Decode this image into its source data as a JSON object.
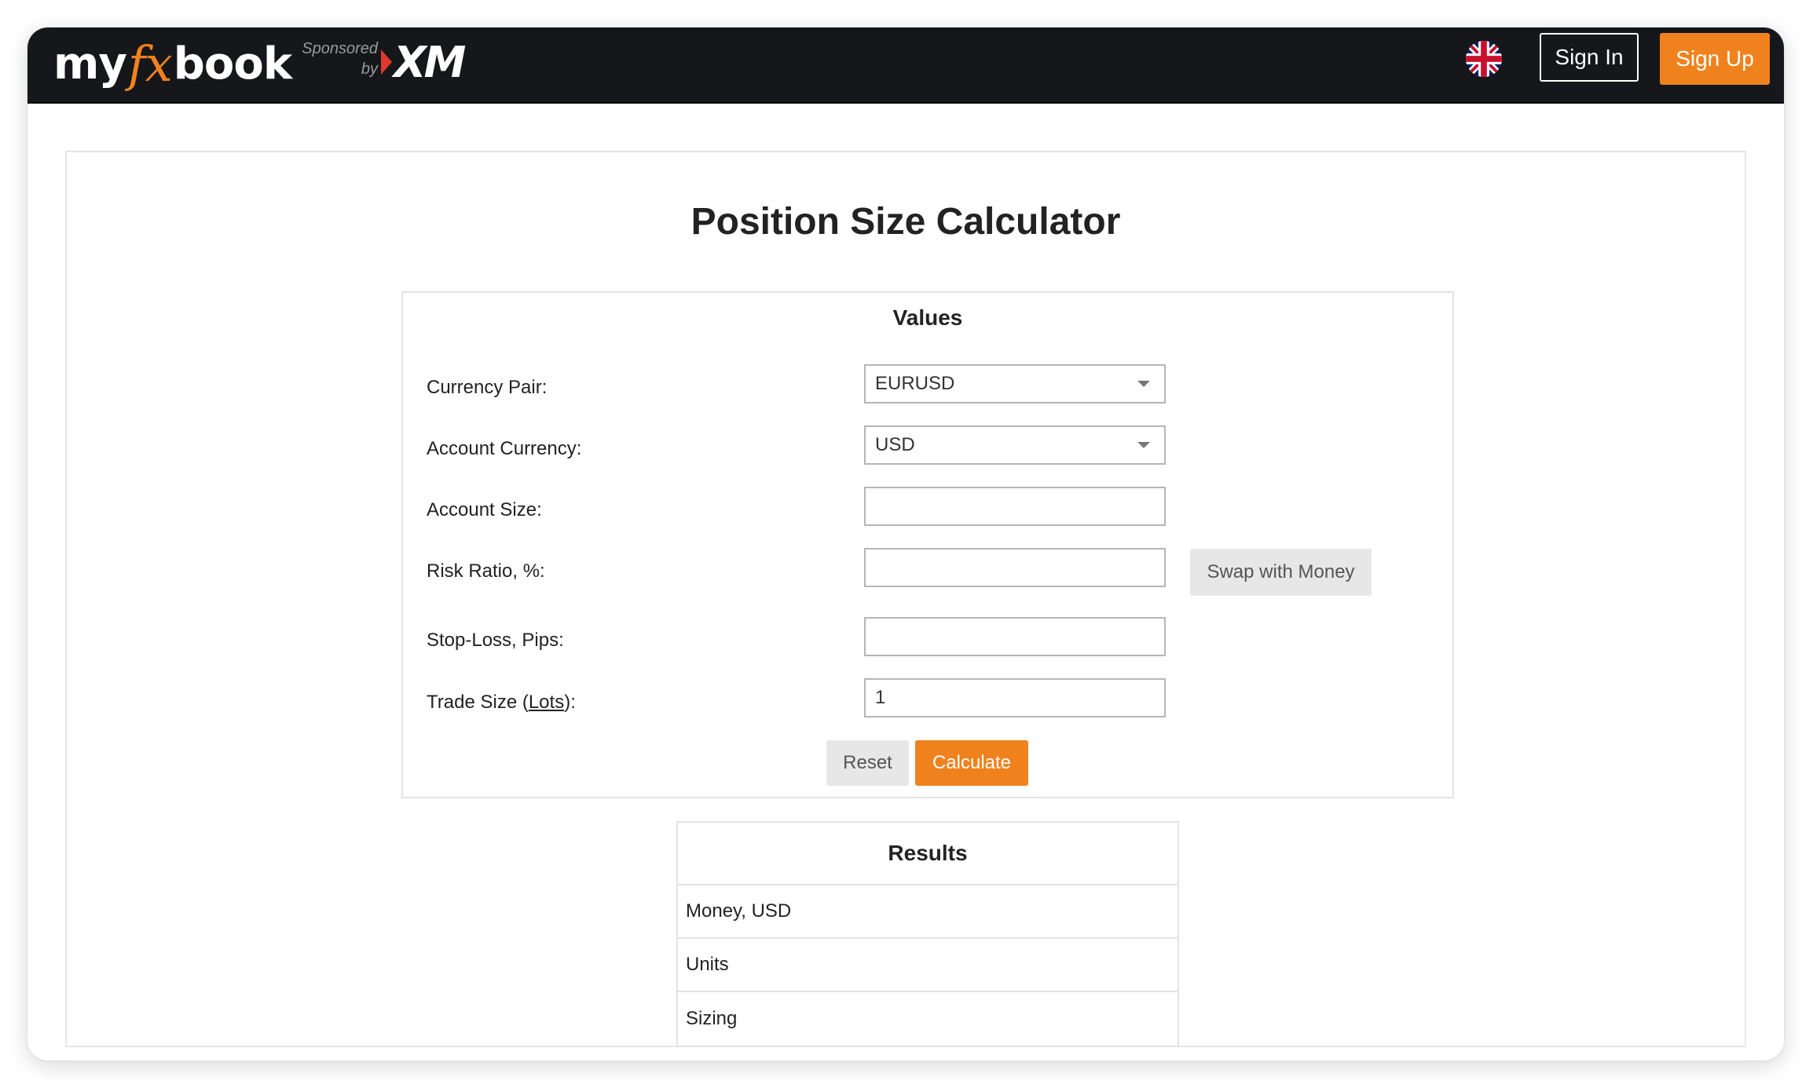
{
  "header": {
    "logo": {
      "part1": "my",
      "part2": "fx",
      "part3": "book"
    },
    "sponsored_line1": "Sponsored",
    "sponsored_line2": "by",
    "sponsor_logo": "XM",
    "language_icon": "uk-flag-icon",
    "sign_in_label": "Sign In",
    "sign_up_label": "Sign Up"
  },
  "page": {
    "title": "Position Size Calculator"
  },
  "values_panel": {
    "title": "Values",
    "fields": {
      "currency_pair": {
        "label": "Currency Pair:",
        "value": "EURUSD"
      },
      "account_currency": {
        "label": "Account Currency:",
        "value": "USD"
      },
      "account_size": {
        "label": "Account Size:",
        "value": ""
      },
      "risk_ratio": {
        "label": "Risk Ratio, %:",
        "value": ""
      },
      "stop_loss": {
        "label": "Stop-Loss, Pips:",
        "value": ""
      },
      "trade_size": {
        "label_prefix": "Trade Size ",
        "label_paren_open": "(",
        "label_link": "Lots",
        "label_paren_close": "):",
        "value": "1"
      }
    },
    "swap_label": "Swap with Money",
    "reset_label": "Reset",
    "calculate_label": "Calculate"
  },
  "results_panel": {
    "title": "Results",
    "rows": [
      "Money, USD",
      "Units",
      "Sizing"
    ]
  },
  "colors": {
    "brand_orange": "#f0821e",
    "header_bg": "#16171b",
    "sponsor_red": "#e0382e"
  }
}
